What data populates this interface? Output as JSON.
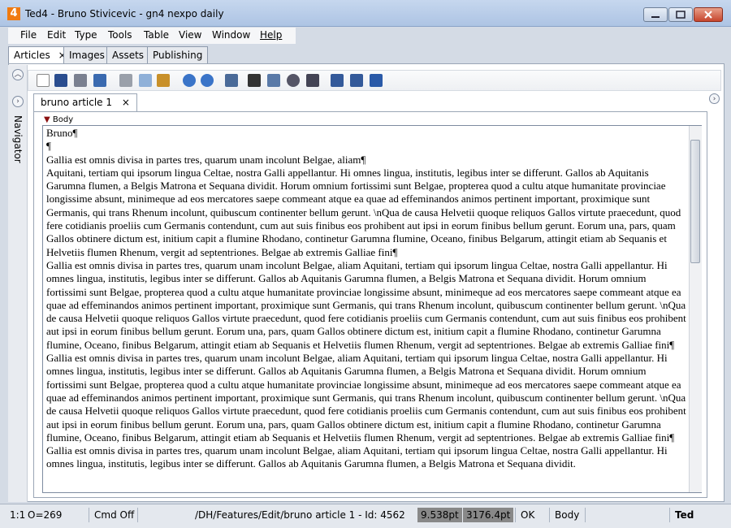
{
  "window": {
    "app_icon_text": "4",
    "title": "Ted4 - Bruno Stivicevic - gn4 nexpo daily"
  },
  "menu": {
    "items": [
      "File",
      "Edit",
      "Type",
      "Tools",
      "Table",
      "View",
      "Window",
      "Help"
    ]
  },
  "tabs": {
    "articles": "Articles",
    "images": "Images",
    "assets": "Assets",
    "publishing": "Publishing",
    "close": "×"
  },
  "navigator": {
    "label": "Navigator"
  },
  "doc_tab": {
    "label": "bruno article 1",
    "close": "×"
  },
  "body_header": {
    "label": "Body"
  },
  "document": {
    "lines": [
      "Bruno¶",
      "¶",
      "Gallia est omnis divisa in partes tres, quarum unam incolunt Belgae, aliam¶",
      " Aquitani, tertiam qui ipsorum lingua Celtae, nostra Galli appellantur. Hi omnes lingua, institutis, legibus inter se differunt. Gallos ab Aquitanis Garumna flumen, a Belgis Matrona et Sequana dividit. Horum omnium fortissimi sunt Belgae, propterea quod a cultu atque humanitate provinciae longissime absunt, minimeque ad eos mercatores saepe commeant atque ea quae ad effeminandos animos pertinent important, proximique sunt Germanis, qui trans Rhenum incolunt, quibuscum continenter bellum gerunt. \\nQua de causa Helvetii quoque reliquos Gallos virtute praecedunt, quod fere cotidianis proeliis cum Germanis contendunt, cum aut suis finibus eos prohibent aut ipsi in eorum finibus bellum gerunt. Eorum una, pars, quam Gallos obtinere dictum est, initium capit a flumine Rhodano, continetur Garumna flumine, Oceano, finibus Belgarum, attingit etiam ab Sequanis et Helvetiis flumen Rhenum, vergit ad septentriones. Belgae ab extremis Galliae fini¶",
      "Gallia est omnis divisa in partes tres, quarum unam incolunt Belgae, aliam Aquitani, tertiam qui ipsorum lingua Celtae, nostra Galli appellantur. Hi omnes lingua, institutis, legibus inter se differunt. Gallos ab Aquitanis Garumna flumen, a Belgis Matrona et Sequana dividit. Horum omnium fortissimi sunt Belgae, propterea quod a cultu atque humanitate provinciae longissime absunt, minimeque ad eos mercatores saepe commeant atque ea quae ad effeminandos animos pertinent important, proximique sunt Germanis, qui trans Rhenum incolunt, quibuscum continenter bellum gerunt. \\nQua de causa Helvetii quoque reliquos Gallos virtute praecedunt, quod fere cotidianis proeliis cum Germanis contendunt, cum aut suis finibus eos prohibent aut ipsi in eorum finibus bellum gerunt. Eorum una, pars, quam Gallos obtinere dictum est, initium capit a flumine Rhodano, continetur Garumna flumine, Oceano, finibus Belgarum, attingit etiam ab Sequanis et Helvetiis flumen Rhenum, vergit ad septentriones. Belgae ab extremis Galliae fini¶",
      "Gallia est omnis divisa in partes tres, quarum unam incolunt Belgae, aliam Aquitani, tertiam qui ipsorum lingua Celtae, nostra Galli appellantur. Hi omnes lingua, institutis, legibus inter se differunt. Gallos ab Aquitanis Garumna flumen, a Belgis Matrona et Sequana dividit. Horum omnium fortissimi sunt Belgae, propterea quod a cultu atque humanitate provinciae longissime absunt, minimeque ad eos mercatores saepe commeant atque ea quae ad effeminandos animos pertinent important, proximique sunt Germanis, qui trans Rhenum incolunt, quibuscum continenter bellum gerunt. \\nQua de causa Helvetii quoque reliquos Gallos virtute praecedunt, quod fere cotidianis proeliis cum Germanis contendunt, cum aut suis finibus eos prohibent aut ipsi in eorum finibus bellum gerunt. Eorum una, pars, quam Gallos obtinere dictum est, initium capit a flumine Rhodano, continetur Garumna flumine, Oceano, finibus Belgarum, attingit etiam ab Sequanis et Helvetiis flumen Rhenum, vergit ad septentriones. Belgae ab extremis Galliae fini¶",
      "Gallia est omnis divisa in partes tres, quarum unam incolunt Belgae, aliam Aquitani, tertiam qui ipsorum lingua Celtae, nostra Galli appellantur. Hi omnes lingua, institutis, legibus inter se differunt. Gallos ab Aquitanis Garumna flumen, a Belgis Matrona et Sequana dividit."
    ]
  },
  "status": {
    "position": "1:1",
    "offset": "O=269",
    "cmd": "Cmd Off",
    "path": "/DH/Features/Edit/bruno article 1 - Id: 4562",
    "size1": "9.538pt",
    "size2": "3176.4pt",
    "ok": "OK",
    "style": "Body",
    "app": "Ted"
  },
  "colors": {
    "accent": "#f07a10",
    "title_bg": "#b8cde9"
  },
  "icons": [
    "new-document-icon",
    "save-icon",
    "print-icon",
    "spellcheck-icon",
    "cut-icon",
    "copy-icon",
    "paste-icon",
    "undo-icon",
    "redo-icon",
    "layout-icon",
    "find-icon",
    "properties-icon",
    "link-icon",
    "special-char-icon",
    "insert-above-icon",
    "insert-below-icon",
    "text-format-icon"
  ]
}
